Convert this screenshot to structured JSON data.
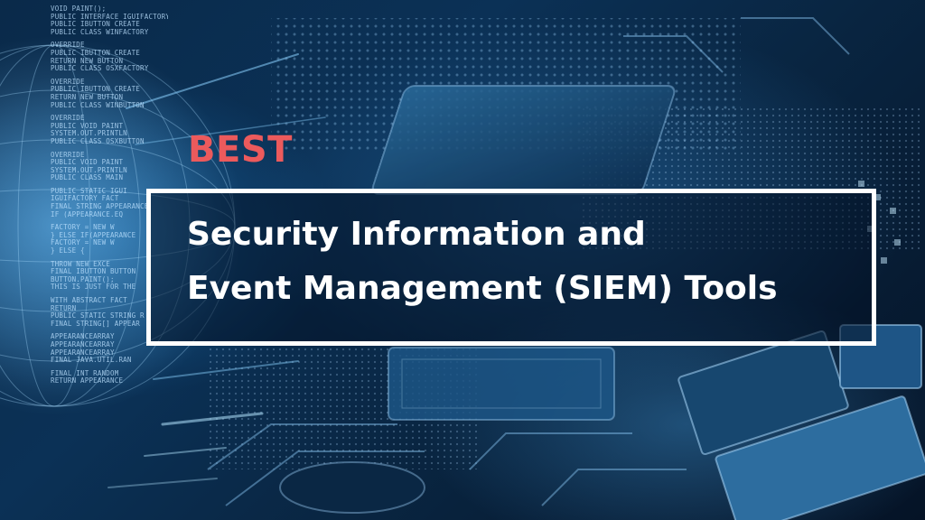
{
  "banner": {
    "eyebrow": "BEST",
    "title_line_1": "Security Information and",
    "title_line_2": "Event Management (SIEM) Tools"
  },
  "background_code": [
    "VOID PAINT();",
    "PUBLIC INTERFACE IGUIFACTORY",
    "PUBLIC IBUTTON CREATE",
    "PUBLIC CLASS WINFACTORY",
    "OVERRIDE",
    "PUBLIC IBUTTON CREATE",
    "RETURN NEW BUTTON",
    "PUBLIC CLASS OSXFACTORY",
    "OVERRIDE",
    "PUBLIC IBUTTON CREATE",
    "RETURN NEW BUTTON",
    "PUBLIC CLASS WINBUTTON",
    "OVERRIDE",
    "PUBLIC VOID PAINT",
    "SYSTEM.OUT.PRINTLN",
    "PUBLIC CLASS OSXBUTTON",
    "OVERRIDE",
    "PUBLIC VOID PAINT",
    "SYSTEM.OUT.PRINTLN",
    "PUBLIC CLASS MAIN",
    "PUBLIC STATIC IGUI",
    "IGUIFACTORY FACT",
    "FINAL STRING APPEARANCE",
    "IF (APPEARANCE.EQ",
    "FACTORY = NEW W",
    "} ELSE IF(APPEARANCE",
    "FACTORY = NEW W",
    "} ELSE {",
    "THROW NEW EXCE",
    "FINAL IBUTTON BUTTON",
    "BUTTON.PAINT();",
    "THIS IS JUST FOR THE",
    "WITH ABSTRACT FACT",
    "RETURN",
    "PUBLIC STATIC STRING R",
    "FINAL STRING[] APPEAR",
    "APPEARANCEARRAY",
    "APPEARANCEARRAY",
    "APPEARANCEARRAY",
    "FINAL JAVA.UTIL.RAN",
    "FINAL INT RANDOM",
    "RETURN APPEARANCE"
  ],
  "colors": {
    "accent": "#ec5a5c",
    "title": "#ffffff",
    "border": "#ffffff"
  }
}
